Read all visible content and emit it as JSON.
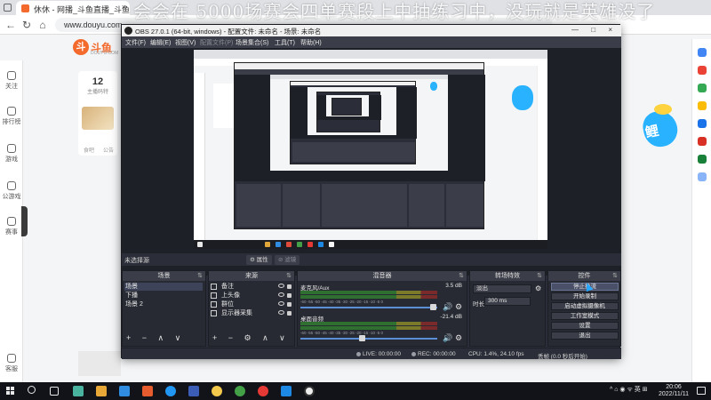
{
  "danmaku": "会会在 5000场赛会四单赛段上中抽练习中，没玩就是英雄没了",
  "browser": {
    "tab_title": "休休 - 网播_斗鱼直播_斗鱼...",
    "tab_close": "×",
    "url": "www.douyu.com",
    "logo_text": "斗鱼",
    "logo_sub": "DOUYU.COM",
    "logo_mark": "斗",
    "right_art_text": "鲤",
    "category_count": "12",
    "category_label": "主播码特",
    "category_a": "食吧",
    "category_b": "公告",
    "left_rail": [
      {
        "label": "关注"
      },
      {
        "label": "排行榜"
      },
      {
        "label": "游戏"
      },
      {
        "label": "公游戏"
      },
      {
        "label": "赛事"
      },
      {
        "label": "客服"
      }
    ]
  },
  "obs": {
    "title": "OBS 27.0.1 (64-bit, windows) - 配置文件: 未命名 - 场景: 未命名",
    "window_controls": "— □ ×",
    "menu": [
      {
        "label": "文件(F)",
        "disabled": false
      },
      {
        "label": "编辑(E)",
        "disabled": false
      },
      {
        "label": "视图(V)",
        "disabled": false
      },
      {
        "label": "配置文件(P)",
        "disabled": true
      },
      {
        "label": "场景集合(S)",
        "disabled": false
      },
      {
        "label": "工具(T)",
        "disabled": false
      },
      {
        "label": "帮助(H)",
        "disabled": false
      }
    ],
    "no_source_selected": "未选择源",
    "properties_btn": "⚙ 属性",
    "filters_btn": "⊘ 滤镜",
    "docks": {
      "scenes": "场景",
      "sources": "来源",
      "mixer": "混音器",
      "transitions": "转场特效",
      "controls": "控件",
      "pin": "⇅"
    },
    "scenes": [
      "场景",
      "下播",
      "场景 2"
    ],
    "sources": [
      "备注",
      "上头像",
      "群位",
      "显示器采集"
    ],
    "scene_footer": "+ − ∧ ∨",
    "source_footer": "+ − ⚙ ∧ ∨",
    "mixer": [
      {
        "name": "麦克风/Aux",
        "db": "3.5 dB"
      },
      {
        "name": "桌面音频",
        "db": "-21.4 dB"
      }
    ],
    "mixer_scale": "-60 -55 -50 -45 -40 -35 -30 -25 -20 -15 -10 -5 0",
    "mixer_vol_icon": "🔊",
    "mixer_gear_icon": "⚙",
    "transition": {
      "selected": "淡出",
      "duration_label": "时长",
      "duration_value": "300 ms",
      "gear": "⚙"
    },
    "controls": [
      {
        "label": "停止推流",
        "active": true
      },
      {
        "label": "开始录制",
        "active": false
      },
      {
        "label": "启动虚拟摄像机",
        "active": false
      },
      {
        "label": "工作室模式",
        "active": false
      },
      {
        "label": "设置",
        "active": false
      },
      {
        "label": "退出",
        "active": false
      }
    ],
    "statusbar": {
      "live": "LIVE: 00:00:00",
      "rec": "REC: 00:00:00",
      "cpu": "CPU: 1.4%, 24.10 fps",
      "dropped": "丢帧 (0.0 秒后开始)"
    }
  },
  "taskbar": {
    "tray": "^  ⌂  ◉  ᯤ  英  ⊞",
    "time": "20:06",
    "date": "2022/11/11"
  },
  "colors": {
    "douyu_orange": "#f36a2c",
    "obs_bg": "#2b2e38",
    "obs_panel": "#272a33",
    "accent_blue": "#27a7ff"
  }
}
